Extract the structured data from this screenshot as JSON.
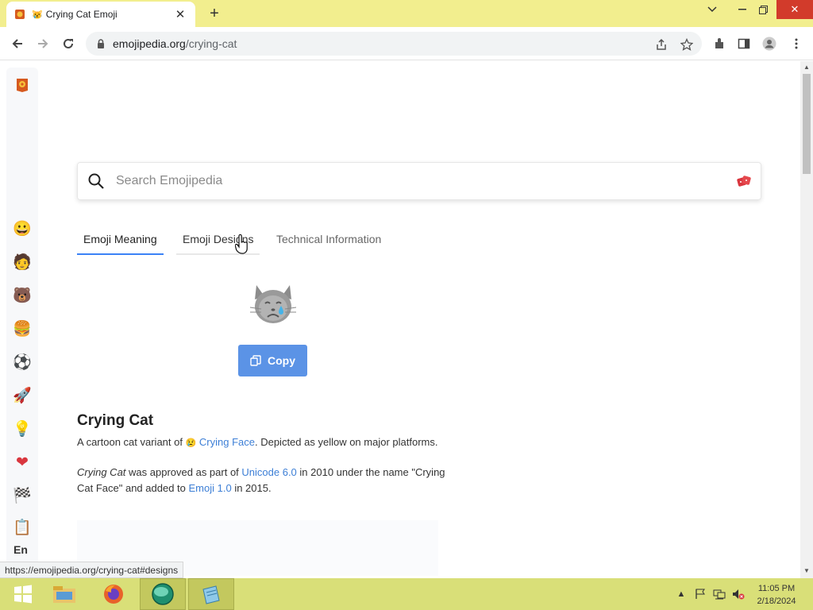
{
  "browser": {
    "tab_title": "Crying Cat Emoji",
    "tab_title_emoji": "😿",
    "url_host": "emojipedia.org",
    "url_path": "/crying-cat",
    "status_url": "https://emojipedia.org/crying-cat#designs"
  },
  "sidebar": {
    "categories": [
      {
        "name": "smileys",
        "glyph": "😀"
      },
      {
        "name": "people",
        "glyph": "🧑"
      },
      {
        "name": "animals",
        "glyph": "🐻"
      },
      {
        "name": "food",
        "glyph": "🍔"
      },
      {
        "name": "activities",
        "glyph": "⚽"
      },
      {
        "name": "travel",
        "glyph": "🚀"
      },
      {
        "name": "objects",
        "glyph": "💡"
      },
      {
        "name": "symbols",
        "glyph": "❤"
      },
      {
        "name": "flags",
        "glyph": "🏁"
      },
      {
        "name": "clipboard",
        "glyph": "📋"
      }
    ],
    "language": "En"
  },
  "search": {
    "placeholder": "Search Emojipedia"
  },
  "tabs": [
    {
      "label": "Emoji Meaning",
      "state": "active"
    },
    {
      "label": "Emoji Designs",
      "state": "hover"
    },
    {
      "label": "Technical Information",
      "state": "normal"
    }
  ],
  "main": {
    "copy_label": "Copy",
    "heading": "Crying Cat",
    "p1_before": "A cartoon cat variant of ",
    "p1_emoji": "😢",
    "p1_link": "Crying Face",
    "p1_after": ". Depicted as yellow on major platforms.",
    "p2_italic": "Crying Cat",
    "p2_text1": " was approved as part of ",
    "p2_link1": "Unicode 6.0",
    "p2_text2": " in 2010 under the name \"Crying Cat Face\" and added to ",
    "p2_link2": "Emoji 1.0",
    "p2_text3": " in 2015."
  },
  "clock": {
    "time": "11:05 PM",
    "date": "2/18/2024"
  },
  "colors": {
    "tabbar": "#f2ee8e",
    "taskbar": "#d9df78",
    "accent_blue": "#3b82f6",
    "copy_button": "#5b93e6",
    "link": "#3d7fd6"
  }
}
